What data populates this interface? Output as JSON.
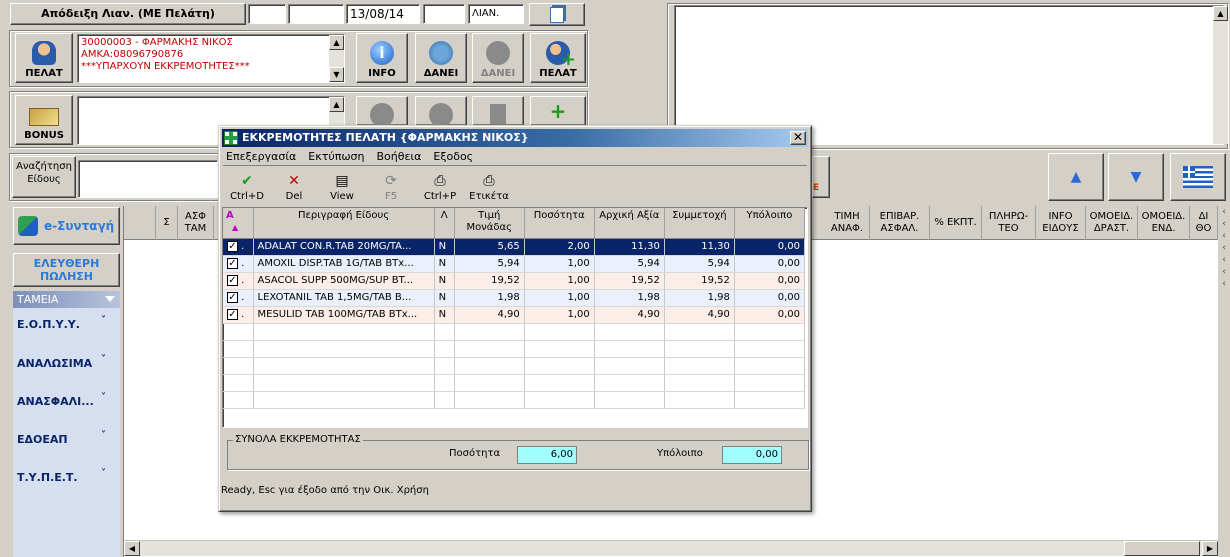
{
  "header": {
    "receipt_label": "Απόδειξη Λιαν. (ΜΕ Πελάτη)",
    "date": "13/08/14",
    "type": "ΛΙΑΝ."
  },
  "customer": {
    "line1": "30000003 - ΦΑΡΜΑΚΗΣ ΝΙΚΟΣ",
    "line2": "ΑΜΚΑ:08096790876",
    "line3": "***ΥΠΑΡΧΟΥΝ ΕΚΚΡΕΜΟΤΗΤΕΣ***"
  },
  "buttons": {
    "pelat": "ΠΕΛΑΤ",
    "info": "INFO",
    "danei": "ΔΑΝΕΙ",
    "danei2": "ΔΑΝΕΙ",
    "pelat_add": "ΠΕΛΑΤ",
    "bonus": "BONUS"
  },
  "search": {
    "label": "Αναζήτηση Είδους"
  },
  "sidebar": {
    "esyntagi": "e-Συνταγή",
    "free_sale": "ΕΛΕΥΘΕΡΗ ΠΩΛΗΣΗ",
    "tameia": "ΤΑΜΕΙΑ",
    "items": [
      {
        "label": "Ε.Ο.Π.Υ.Υ."
      },
      {
        "label": "ΑΝΑΛΩΣΙΜΑ"
      },
      {
        "label": "ΑΝΑΣΦΑΛΙ..."
      },
      {
        "label": "ΕΔΟΕΑΠ"
      },
      {
        "label": "Τ.Υ.Π.Ε.Τ."
      }
    ]
  },
  "bg_columns": {
    "c1": "Σ",
    "c2": "ΑΣΦ ΤΑΜ",
    "c3": "ΤΙΜΗ ΑΝΑΦ.",
    "c4": "ΕΠΙΒΑΡ. ΑΣΦΑΛ.",
    "c5": "% ΕΚΠΤ.",
    "c6": "ΠΛΗΡΩ- ΤΕΟ",
    "c7": "INFO ΕΙΔΟΥΣ",
    "c8": "ΟΜΟΕΙΔ. ΔΡΑΣΤ.",
    "c9": "ΟΜΟΕΙΔ. ΕΝΔ.",
    "c10": "ΔΙ ΘΟ"
  },
  "dialog": {
    "title": "ΕΚΚΡΕΜΟΤΗΤΕΣ ΠΕΛΑΤΗ  {ΦΑΡΜΑΚΗΣ ΝΙΚΟΣ}",
    "menu": [
      "Επεξεργασία",
      "Εκτύπωση",
      "Βοήθεια",
      "Εξοδος"
    ],
    "toolbar": {
      "ok": "Ctrl+D",
      "del": "Del",
      "view": "View",
      "f5": "F5",
      "print": "Ctrl+P",
      "label": "Ετικέτα"
    },
    "columns": [
      "A",
      "Περιγραφή Είδους",
      "Λ",
      "Τιμή Μονάδας",
      "Ποσότητα",
      "Αρχική Αξία",
      "Συμμετοχή",
      "Υπόλοιπο"
    ],
    "rows": [
      {
        "desc": "ADALAT CON.R.TAB 20MG/TA...",
        "l": "N",
        "price": "5,65",
        "qty": "2,00",
        "init": "11,30",
        "part": "11,30",
        "rem": "0,00"
      },
      {
        "desc": "AMOXIL DISP.TAB 1G/TAB BTx...",
        "l": "N",
        "price": "5,94",
        "qty": "1,00",
        "init": "5,94",
        "part": "5,94",
        "rem": "0,00"
      },
      {
        "desc": "ASACOL SUPP 500MG/SUP BT...",
        "l": "N",
        "price": "19,52",
        "qty": "1,00",
        "init": "19,52",
        "part": "19,52",
        "rem": "0,00"
      },
      {
        "desc": "LEXOTANIL TAB 1,5MG/TAB B...",
        "l": "N",
        "price": "1,98",
        "qty": "1,00",
        "init": "1,98",
        "part": "1,98",
        "rem": "0,00"
      },
      {
        "desc": "MESULID TAB 100MG/TAB BTx...",
        "l": "N",
        "price": "4,90",
        "qty": "1,00",
        "init": "4,90",
        "part": "4,90",
        "rem": "0,00"
      }
    ],
    "totals": {
      "group": "ΣΥΝΟΛΑ ΕΚΚΡΕΜΟΤΗΤΑΣ",
      "qty_label": "Ποσότητα",
      "qty": "6,00",
      "rem_label": "Υπόλοιπο",
      "rem": "0,00"
    },
    "status": "Ready, Esc για έξοδο από την Οικ. Χρήση"
  }
}
